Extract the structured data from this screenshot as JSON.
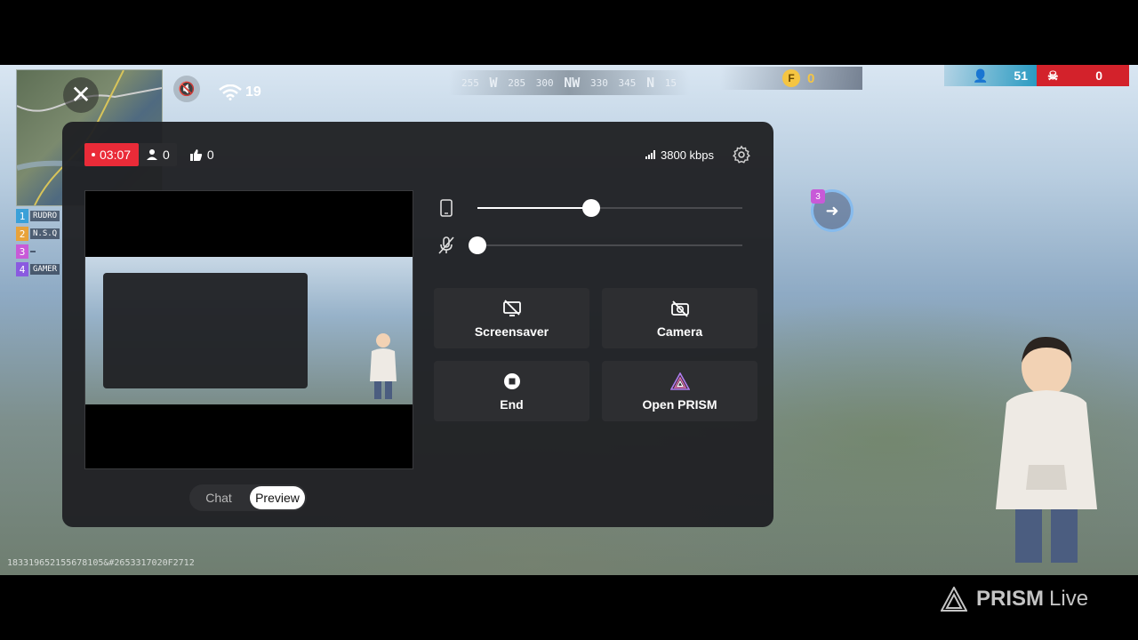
{
  "game_hud": {
    "ping": "19",
    "compass": [
      "255",
      "W",
      "285",
      "300",
      "NW",
      "330",
      "345",
      "N",
      "15"
    ],
    "coins": "0",
    "alive_count": "51",
    "kill_count": "0",
    "squad": [
      {
        "num": "1",
        "name": "RUDRO",
        "color": "#3aa0d8"
      },
      {
        "num": "2",
        "name": "N.S.Q",
        "color": "#e8a23a"
      },
      {
        "num": "3",
        "name": "",
        "color": "#c85ad8"
      },
      {
        "num": "4",
        "name": "GAMER",
        "color": "#8a5ae0"
      }
    ],
    "marker_number": "3",
    "coordinate_code": "183319652155678105&#2653317020F2712"
  },
  "stream_panel": {
    "live_time": "03:07",
    "viewers": "0",
    "likes": "0",
    "bitrate": "3800 kbps",
    "video_volume": 0.43,
    "mic_volume": 0.0,
    "actions": [
      {
        "label": "Screensaver",
        "icon": "screensaver-off-icon"
      },
      {
        "label": "Camera",
        "icon": "camera-off-icon"
      },
      {
        "label": "End",
        "icon": "stop-icon"
      },
      {
        "label": "Open PRISM",
        "icon": "prism-logo-icon"
      }
    ],
    "tabs": {
      "chat": "Chat",
      "preview": "Preview"
    },
    "selected_tab": "Preview"
  },
  "watermark": {
    "brand": "PRISM",
    "suffix": "Live"
  }
}
